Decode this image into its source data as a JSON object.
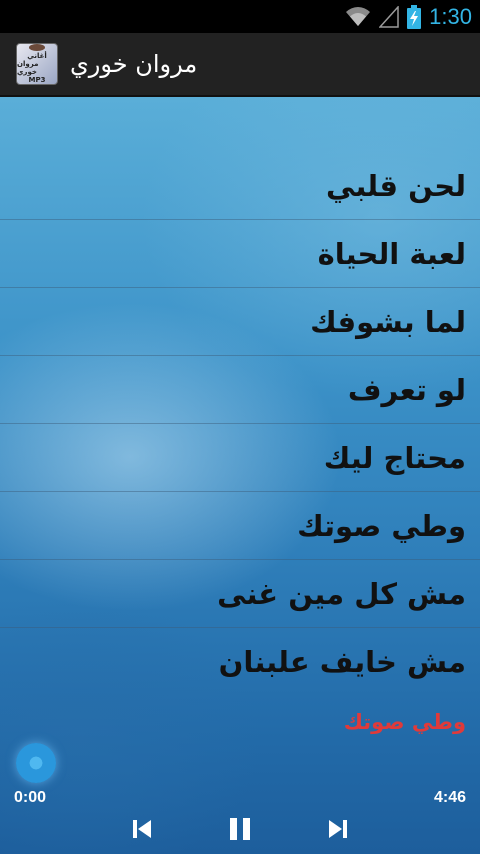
{
  "status_bar": {
    "time": "1:30",
    "icons": [
      "wifi-icon",
      "signal-icon",
      "battery-charging-icon"
    ]
  },
  "action_bar": {
    "title": "مروان خوري",
    "app_icon_text": [
      "أغاني",
      "مروان خوري",
      "MP3"
    ]
  },
  "songs": [
    {
      "label": "لحن قلبي"
    },
    {
      "label": "لعبة الحياة"
    },
    {
      "label": "لما بشوفك"
    },
    {
      "label": "لو تعرف"
    },
    {
      "label": "محتاج ليك"
    },
    {
      "label": "وطي صوتك"
    },
    {
      "label": "مش كل مين غنى"
    },
    {
      "label": "مش خايف علبنان"
    }
  ],
  "player": {
    "now_playing": "وطي صوتك",
    "current_time": "0:00",
    "total_time": "4:46",
    "progress": 0,
    "accent_color": "#33b5e5",
    "now_playing_color": "#e03a3a",
    "controls": [
      "previous-icon",
      "pause-icon",
      "next-icon"
    ]
  }
}
